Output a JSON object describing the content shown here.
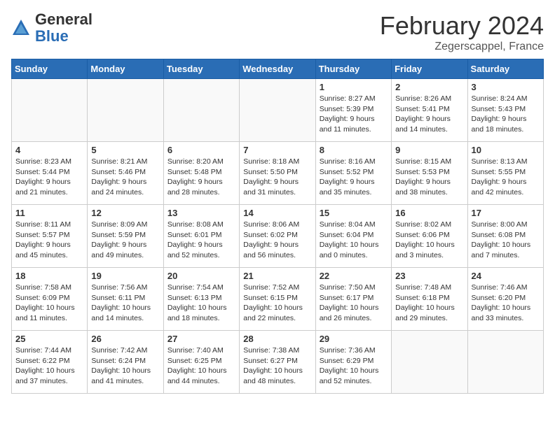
{
  "header": {
    "logo_general": "General",
    "logo_blue": "Blue",
    "month_title": "February 2024",
    "location": "Zegerscappel, France"
  },
  "days_of_week": [
    "Sunday",
    "Monday",
    "Tuesday",
    "Wednesday",
    "Thursday",
    "Friday",
    "Saturday"
  ],
  "weeks": [
    [
      {
        "day": "",
        "info": ""
      },
      {
        "day": "",
        "info": ""
      },
      {
        "day": "",
        "info": ""
      },
      {
        "day": "",
        "info": ""
      },
      {
        "day": "1",
        "info": "Sunrise: 8:27 AM\nSunset: 5:39 PM\nDaylight: 9 hours\nand 11 minutes."
      },
      {
        "day": "2",
        "info": "Sunrise: 8:26 AM\nSunset: 5:41 PM\nDaylight: 9 hours\nand 14 minutes."
      },
      {
        "day": "3",
        "info": "Sunrise: 8:24 AM\nSunset: 5:43 PM\nDaylight: 9 hours\nand 18 minutes."
      }
    ],
    [
      {
        "day": "4",
        "info": "Sunrise: 8:23 AM\nSunset: 5:44 PM\nDaylight: 9 hours\nand 21 minutes."
      },
      {
        "day": "5",
        "info": "Sunrise: 8:21 AM\nSunset: 5:46 PM\nDaylight: 9 hours\nand 24 minutes."
      },
      {
        "day": "6",
        "info": "Sunrise: 8:20 AM\nSunset: 5:48 PM\nDaylight: 9 hours\nand 28 minutes."
      },
      {
        "day": "7",
        "info": "Sunrise: 8:18 AM\nSunset: 5:50 PM\nDaylight: 9 hours\nand 31 minutes."
      },
      {
        "day": "8",
        "info": "Sunrise: 8:16 AM\nSunset: 5:52 PM\nDaylight: 9 hours\nand 35 minutes."
      },
      {
        "day": "9",
        "info": "Sunrise: 8:15 AM\nSunset: 5:53 PM\nDaylight: 9 hours\nand 38 minutes."
      },
      {
        "day": "10",
        "info": "Sunrise: 8:13 AM\nSunset: 5:55 PM\nDaylight: 9 hours\nand 42 minutes."
      }
    ],
    [
      {
        "day": "11",
        "info": "Sunrise: 8:11 AM\nSunset: 5:57 PM\nDaylight: 9 hours\nand 45 minutes."
      },
      {
        "day": "12",
        "info": "Sunrise: 8:09 AM\nSunset: 5:59 PM\nDaylight: 9 hours\nand 49 minutes."
      },
      {
        "day": "13",
        "info": "Sunrise: 8:08 AM\nSunset: 6:01 PM\nDaylight: 9 hours\nand 52 minutes."
      },
      {
        "day": "14",
        "info": "Sunrise: 8:06 AM\nSunset: 6:02 PM\nDaylight: 9 hours\nand 56 minutes."
      },
      {
        "day": "15",
        "info": "Sunrise: 8:04 AM\nSunset: 6:04 PM\nDaylight: 10 hours\nand 0 minutes."
      },
      {
        "day": "16",
        "info": "Sunrise: 8:02 AM\nSunset: 6:06 PM\nDaylight: 10 hours\nand 3 minutes."
      },
      {
        "day": "17",
        "info": "Sunrise: 8:00 AM\nSunset: 6:08 PM\nDaylight: 10 hours\nand 7 minutes."
      }
    ],
    [
      {
        "day": "18",
        "info": "Sunrise: 7:58 AM\nSunset: 6:09 PM\nDaylight: 10 hours\nand 11 minutes."
      },
      {
        "day": "19",
        "info": "Sunrise: 7:56 AM\nSunset: 6:11 PM\nDaylight: 10 hours\nand 14 minutes."
      },
      {
        "day": "20",
        "info": "Sunrise: 7:54 AM\nSunset: 6:13 PM\nDaylight: 10 hours\nand 18 minutes."
      },
      {
        "day": "21",
        "info": "Sunrise: 7:52 AM\nSunset: 6:15 PM\nDaylight: 10 hours\nand 22 minutes."
      },
      {
        "day": "22",
        "info": "Sunrise: 7:50 AM\nSunset: 6:17 PM\nDaylight: 10 hours\nand 26 minutes."
      },
      {
        "day": "23",
        "info": "Sunrise: 7:48 AM\nSunset: 6:18 PM\nDaylight: 10 hours\nand 29 minutes."
      },
      {
        "day": "24",
        "info": "Sunrise: 7:46 AM\nSunset: 6:20 PM\nDaylight: 10 hours\nand 33 minutes."
      }
    ],
    [
      {
        "day": "25",
        "info": "Sunrise: 7:44 AM\nSunset: 6:22 PM\nDaylight: 10 hours\nand 37 minutes."
      },
      {
        "day": "26",
        "info": "Sunrise: 7:42 AM\nSunset: 6:24 PM\nDaylight: 10 hours\nand 41 minutes."
      },
      {
        "day": "27",
        "info": "Sunrise: 7:40 AM\nSunset: 6:25 PM\nDaylight: 10 hours\nand 44 minutes."
      },
      {
        "day": "28",
        "info": "Sunrise: 7:38 AM\nSunset: 6:27 PM\nDaylight: 10 hours\nand 48 minutes."
      },
      {
        "day": "29",
        "info": "Sunrise: 7:36 AM\nSunset: 6:29 PM\nDaylight: 10 hours\nand 52 minutes."
      },
      {
        "day": "",
        "info": ""
      },
      {
        "day": "",
        "info": ""
      }
    ]
  ]
}
